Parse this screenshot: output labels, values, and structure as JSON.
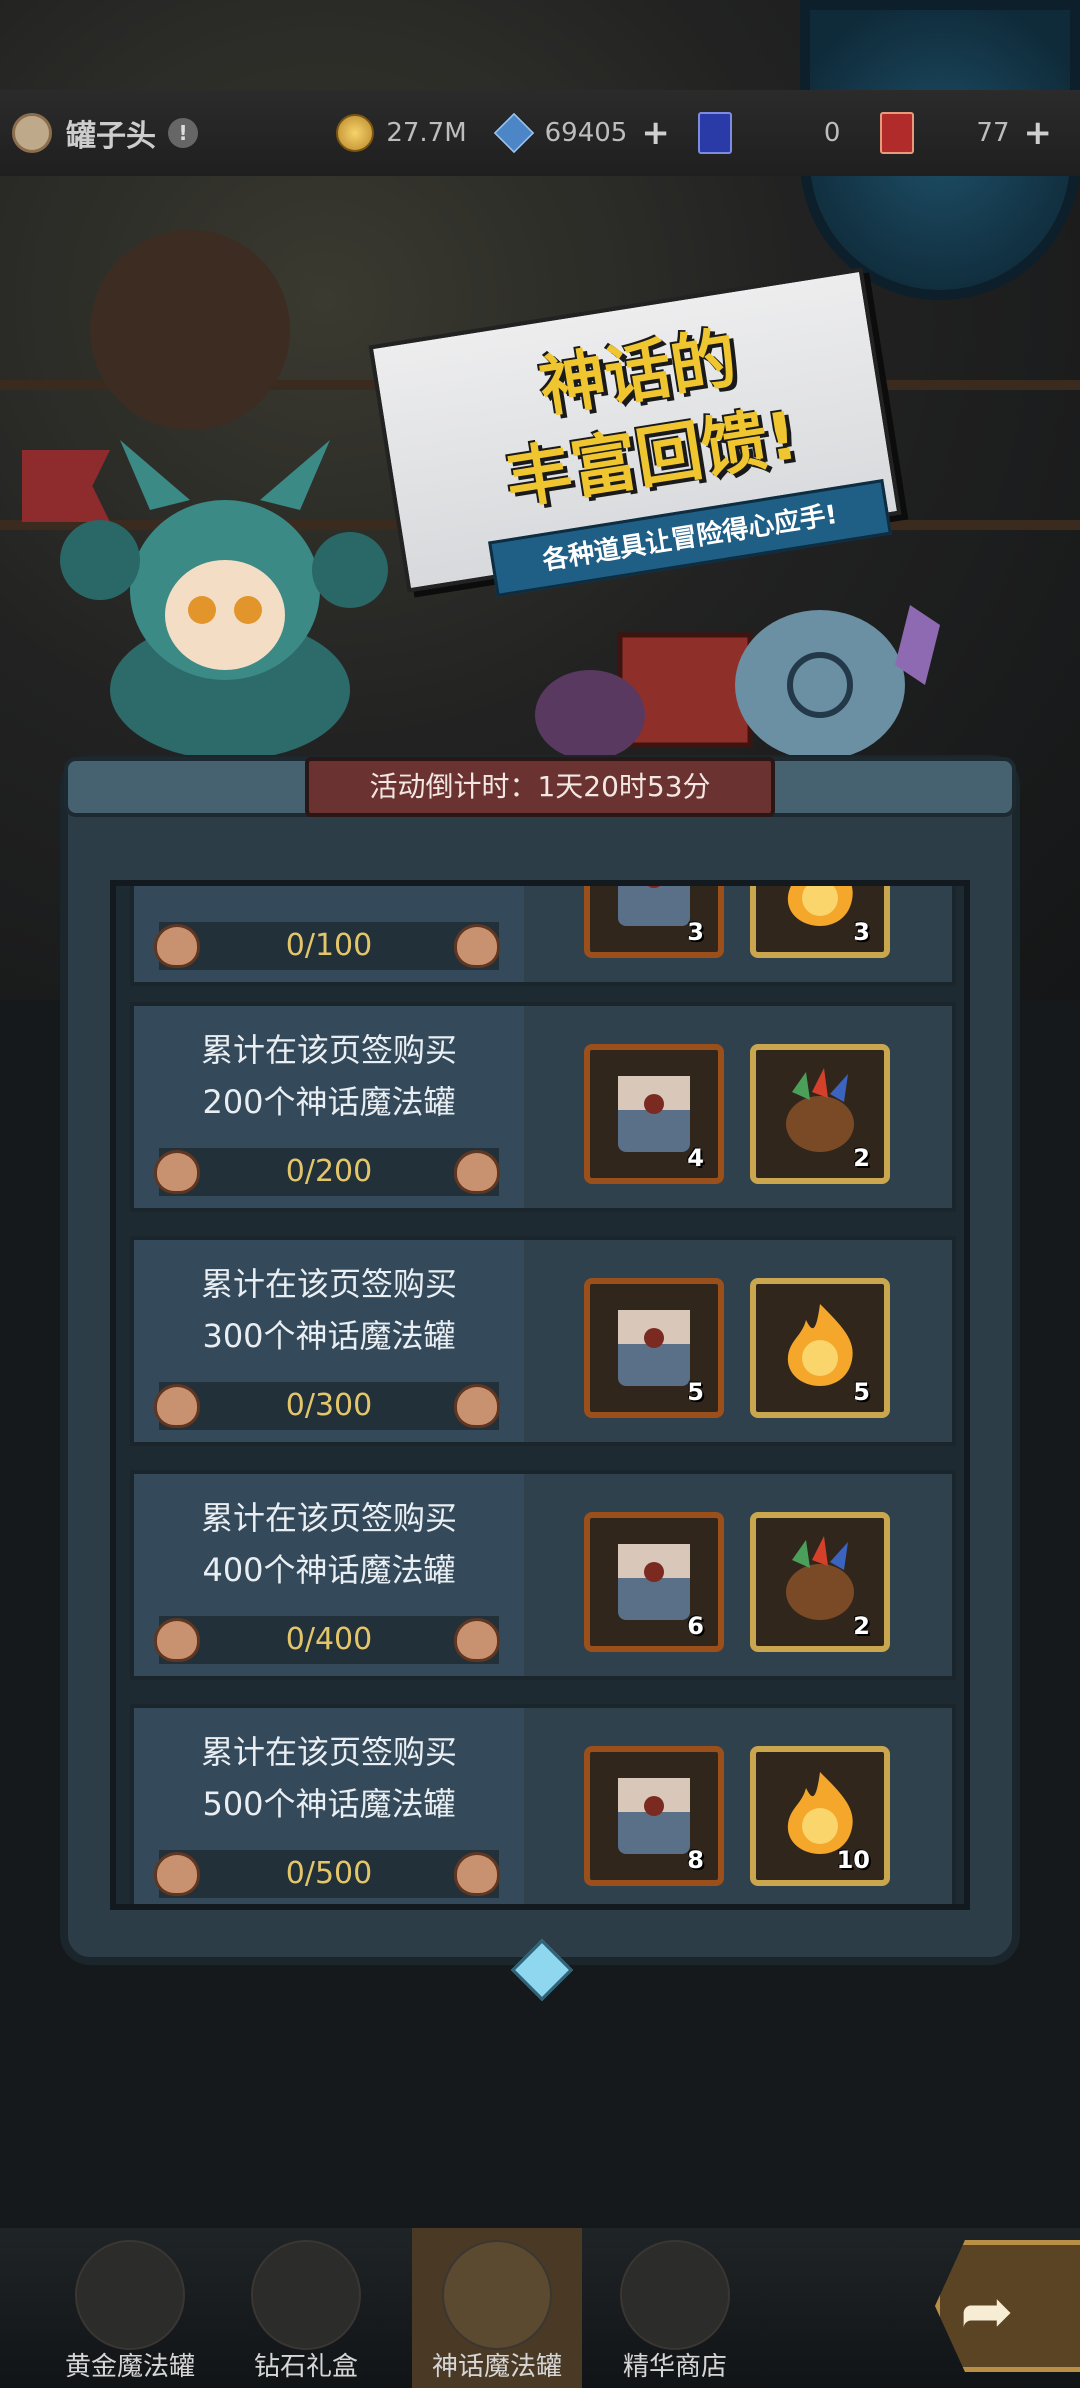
{
  "header": {
    "player_name": "罐子头",
    "info_label": "!",
    "resources": [
      {
        "icon": "gold-coin-icon",
        "value": "27.7M",
        "has_plus": false
      },
      {
        "icon": "crystal-icon",
        "value": "69405",
        "has_plus": true
      },
      {
        "icon": "blue-ticket-icon",
        "value": "0",
        "has_plus": false
      },
      {
        "icon": "red-ticket-icon",
        "value": "77",
        "has_plus": true
      }
    ],
    "plus_label": "+"
  },
  "banner": {
    "title_line1": "神话的",
    "title_line2": "丰富回馈!",
    "subtitle": "各种道具让冒险得心应手!"
  },
  "countdown": "活动倒计时：1天20时53分",
  "tasks": [
    {
      "desc_line1": "",
      "desc_line2": "",
      "progress": "0/100",
      "rewards": [
        {
          "icon": "paw-chest-icon",
          "qty": "3"
        },
        {
          "icon": "fireball-icon",
          "qty": "3"
        }
      ]
    },
    {
      "desc_line1": "累计在该页签购买",
      "desc_line2": "200个神话魔法罐",
      "progress": "0/200",
      "rewards": [
        {
          "icon": "paw-chest-icon",
          "qty": "4"
        },
        {
          "icon": "feather-bag-icon",
          "qty": "2"
        }
      ]
    },
    {
      "desc_line1": "累计在该页签购买",
      "desc_line2": "300个神话魔法罐",
      "progress": "0/300",
      "rewards": [
        {
          "icon": "paw-chest-icon",
          "qty": "5"
        },
        {
          "icon": "fireball-icon",
          "qty": "5"
        }
      ]
    },
    {
      "desc_line1": "累计在该页签购买",
      "desc_line2": "400个神话魔法罐",
      "progress": "0/400",
      "rewards": [
        {
          "icon": "paw-chest-icon",
          "qty": "6"
        },
        {
          "icon": "feather-bag-icon",
          "qty": "2"
        }
      ]
    },
    {
      "desc_line1": "累计在该页签购买",
      "desc_line2": "500个神话魔法罐",
      "progress": "0/500",
      "rewards": [
        {
          "icon": "paw-chest-icon",
          "qty": "8"
        },
        {
          "icon": "fireball-icon",
          "qty": "10"
        }
      ]
    }
  ],
  "nav": {
    "items": [
      {
        "label": "黄金魔法罐",
        "icon": "gold-pot-icon",
        "active": false
      },
      {
        "label": "钻石礼盒",
        "icon": "diamond-box-icon",
        "active": false
      },
      {
        "label": "神话魔法罐",
        "icon": "myth-pot-icon",
        "active": true
      },
      {
        "label": "精华商店",
        "icon": "essence-shop-icon",
        "active": false
      }
    ],
    "share_icon": "share-arrow-icon",
    "share_glyph": "➦"
  },
  "colors": {
    "accent_gold": "#f0c630",
    "progress_text": "#e4c66a",
    "countdown_bg": "#6b3232",
    "panel_bg": "#2c3d48"
  }
}
